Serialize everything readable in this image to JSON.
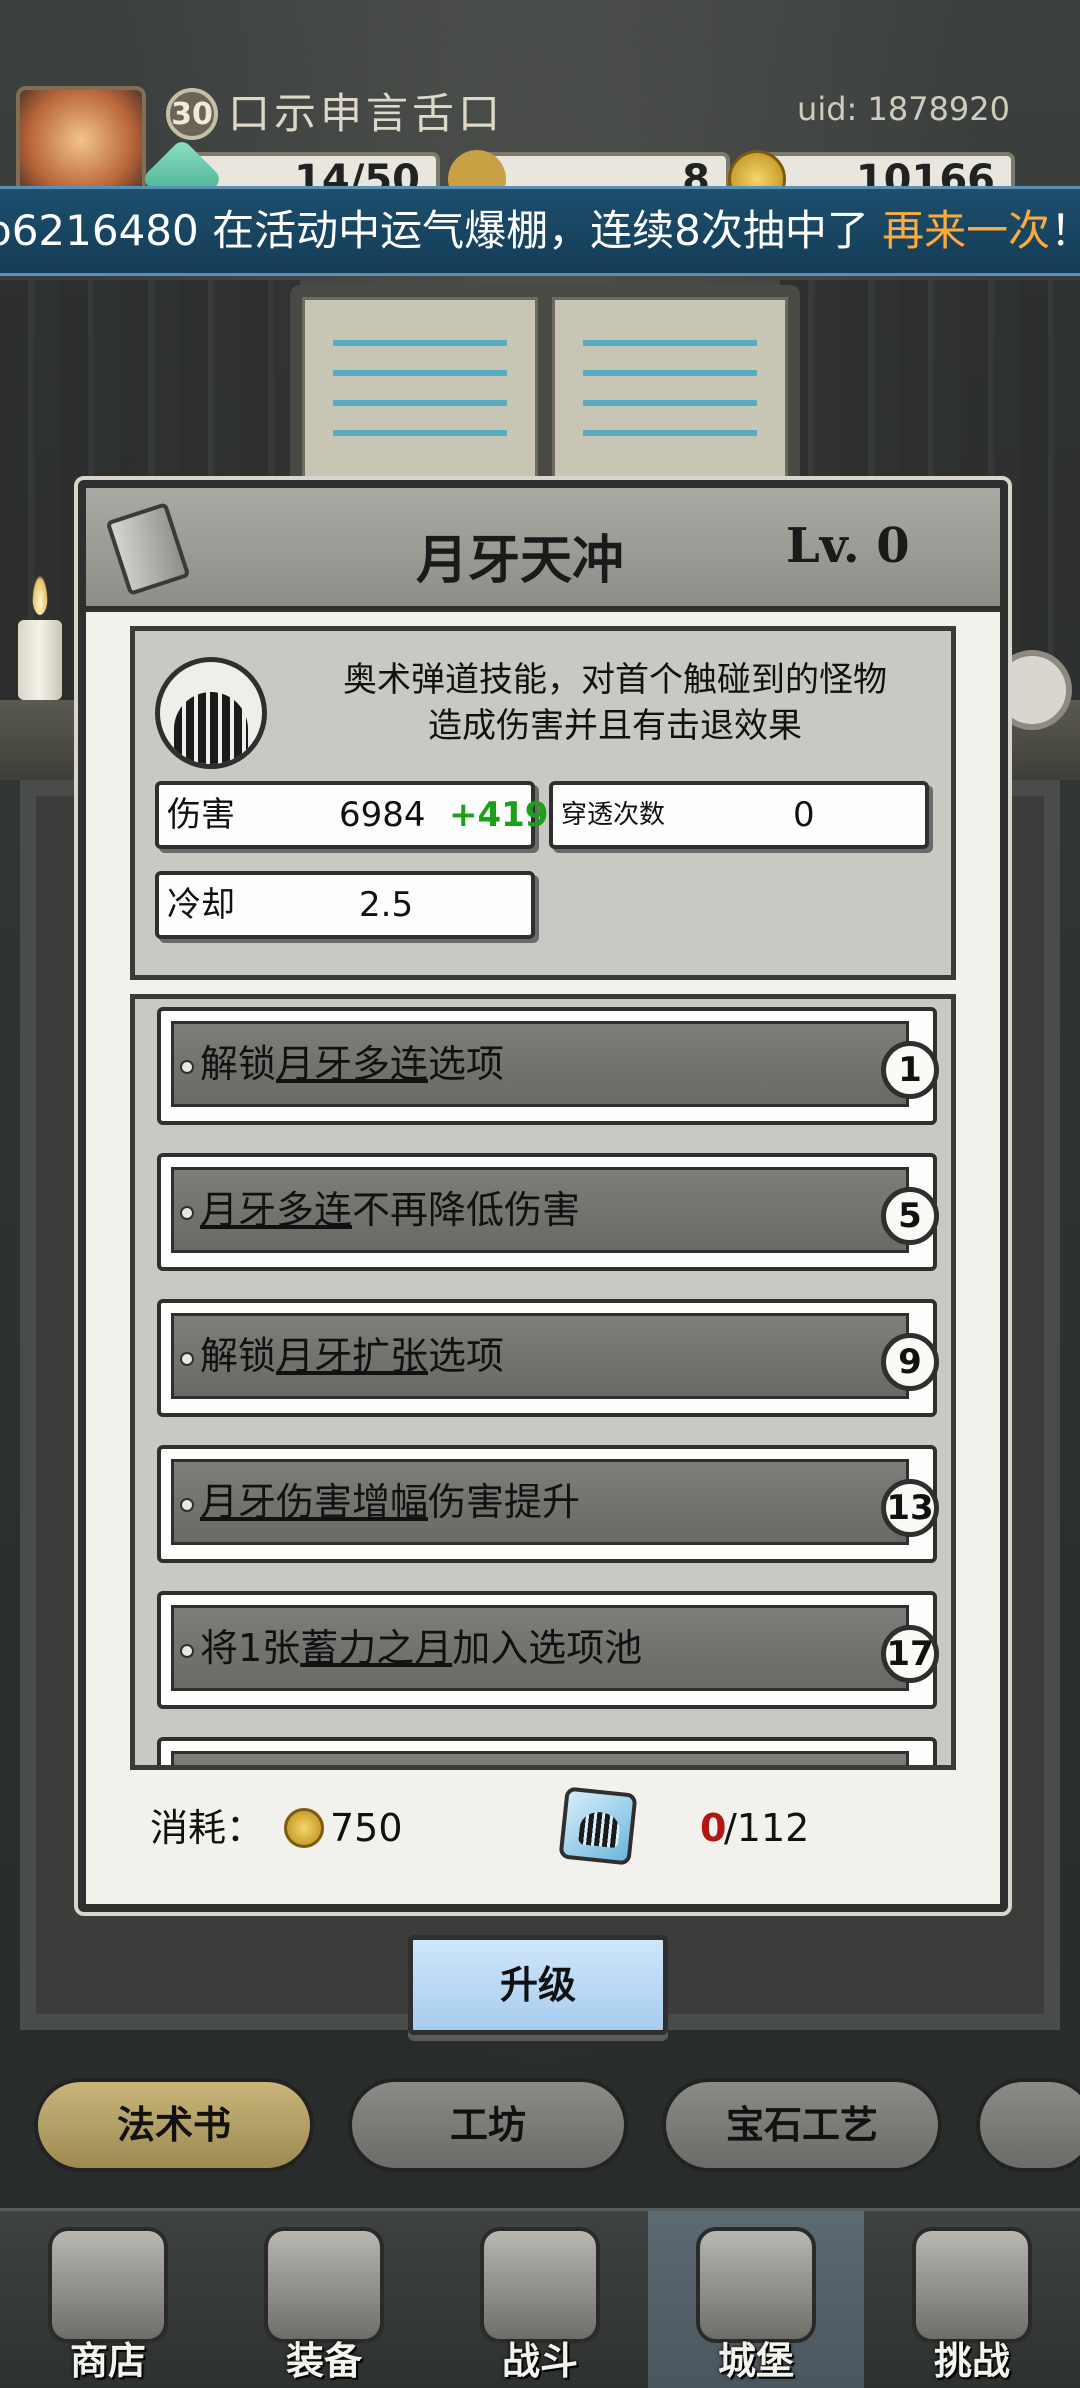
{
  "header": {
    "player_level": "30",
    "player_name": "口示申言舌口",
    "uid": "uid: 1878920",
    "resources": [
      {
        "icon": "gem-icon",
        "value": "14/50"
      },
      {
        "icon": "bag-icon",
        "value": "8"
      },
      {
        "icon": "coin-icon",
        "value": "10166"
      }
    ]
  },
  "marquee": {
    "prefix": "o6216480 在活动中运气爆棚，连续8次抽中了 ",
    "highlight": "再来一次",
    "suffix": "！"
  },
  "skill": {
    "title": "月牙天冲",
    "level": "Lv. 0",
    "description_line1": "奥术弹道技能，对首个触碰到的怪物",
    "description_line2": "造成伤害并且有击退效果",
    "stats": {
      "damage_label": "伤害",
      "damage_value": "6984",
      "damage_bonus": "+419",
      "pierce_label": "穿透次数",
      "pierce_value": "0",
      "cooldown_label": "冷却",
      "cooldown_value": "2.5"
    }
  },
  "upgrades": [
    {
      "pre": "解锁",
      "link": "月牙多连",
      "post": "选项",
      "req": "1"
    },
    {
      "pre": "",
      "link": "月牙多连",
      "post": "不再降低伤害",
      "req": "5"
    },
    {
      "pre": "解锁",
      "link": "月牙扩张",
      "post": "选项",
      "req": "9"
    },
    {
      "pre": "",
      "link": "月牙伤害增幅",
      "post": "伤害提升",
      "req": "13"
    },
    {
      "pre": "将1张",
      "link": "蓄力之月",
      "post": "加入选项池",
      "req": "17"
    }
  ],
  "cost": {
    "label": "消耗：",
    "coins": "750",
    "material_have": "0",
    "material_need": "/112"
  },
  "upgrade_button": "升级",
  "category_tabs": [
    "法术书",
    "工坊",
    "宝石工艺",
    ""
  ],
  "bottom_nav": [
    "商店",
    "装备",
    "战斗",
    "城堡",
    "挑战"
  ],
  "colors": {
    "marquee_highlight": "#ffaa3a",
    "damage_bonus": "#1aa01a",
    "material_have": "#b11616",
    "upgrade_button": "#bcdaf5"
  }
}
